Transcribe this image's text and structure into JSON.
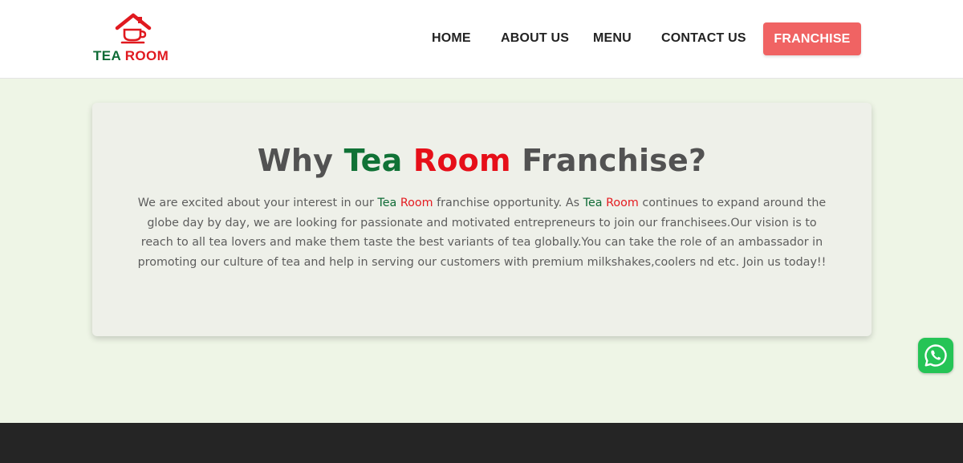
{
  "brand": {
    "part1": "TEA",
    "part2": "ROOM",
    "logo_icon": "house-with-teacup-icon"
  },
  "nav": {
    "home": "HOME",
    "about": "ABOUT US",
    "menu": "MENU",
    "contact": "CONTACT US",
    "franchise": "FRANCHISE"
  },
  "heading": {
    "why": "Why",
    "tea": "Tea",
    "room": "Room",
    "franchise": "Franchise?"
  },
  "intro": {
    "p1": "We are excited about your interest in our",
    "tea1": "Tea",
    "room1": "Room",
    "p2": "franchise opportunity. As",
    "tea2": "Tea",
    "room2": "Room",
    "p3": "continues to expand around the globe day by day, we are looking for passionate and motivated entrepreneurs to join our franchisees.Our vision is to reach to all tea lovers and make them taste the best variants of tea globally.You can take the role of an ambassador in promoting our culture of tea and help in serving our customers with premium milkshakes,coolers nd etc. Join us today!!"
  },
  "floating": {
    "icon": "whatsapp-icon"
  },
  "colors": {
    "accent": "#f06363",
    "green": "#107236",
    "red": "#e60f19",
    "page_bg": "#eef5e6",
    "footer_bg": "#252525"
  }
}
